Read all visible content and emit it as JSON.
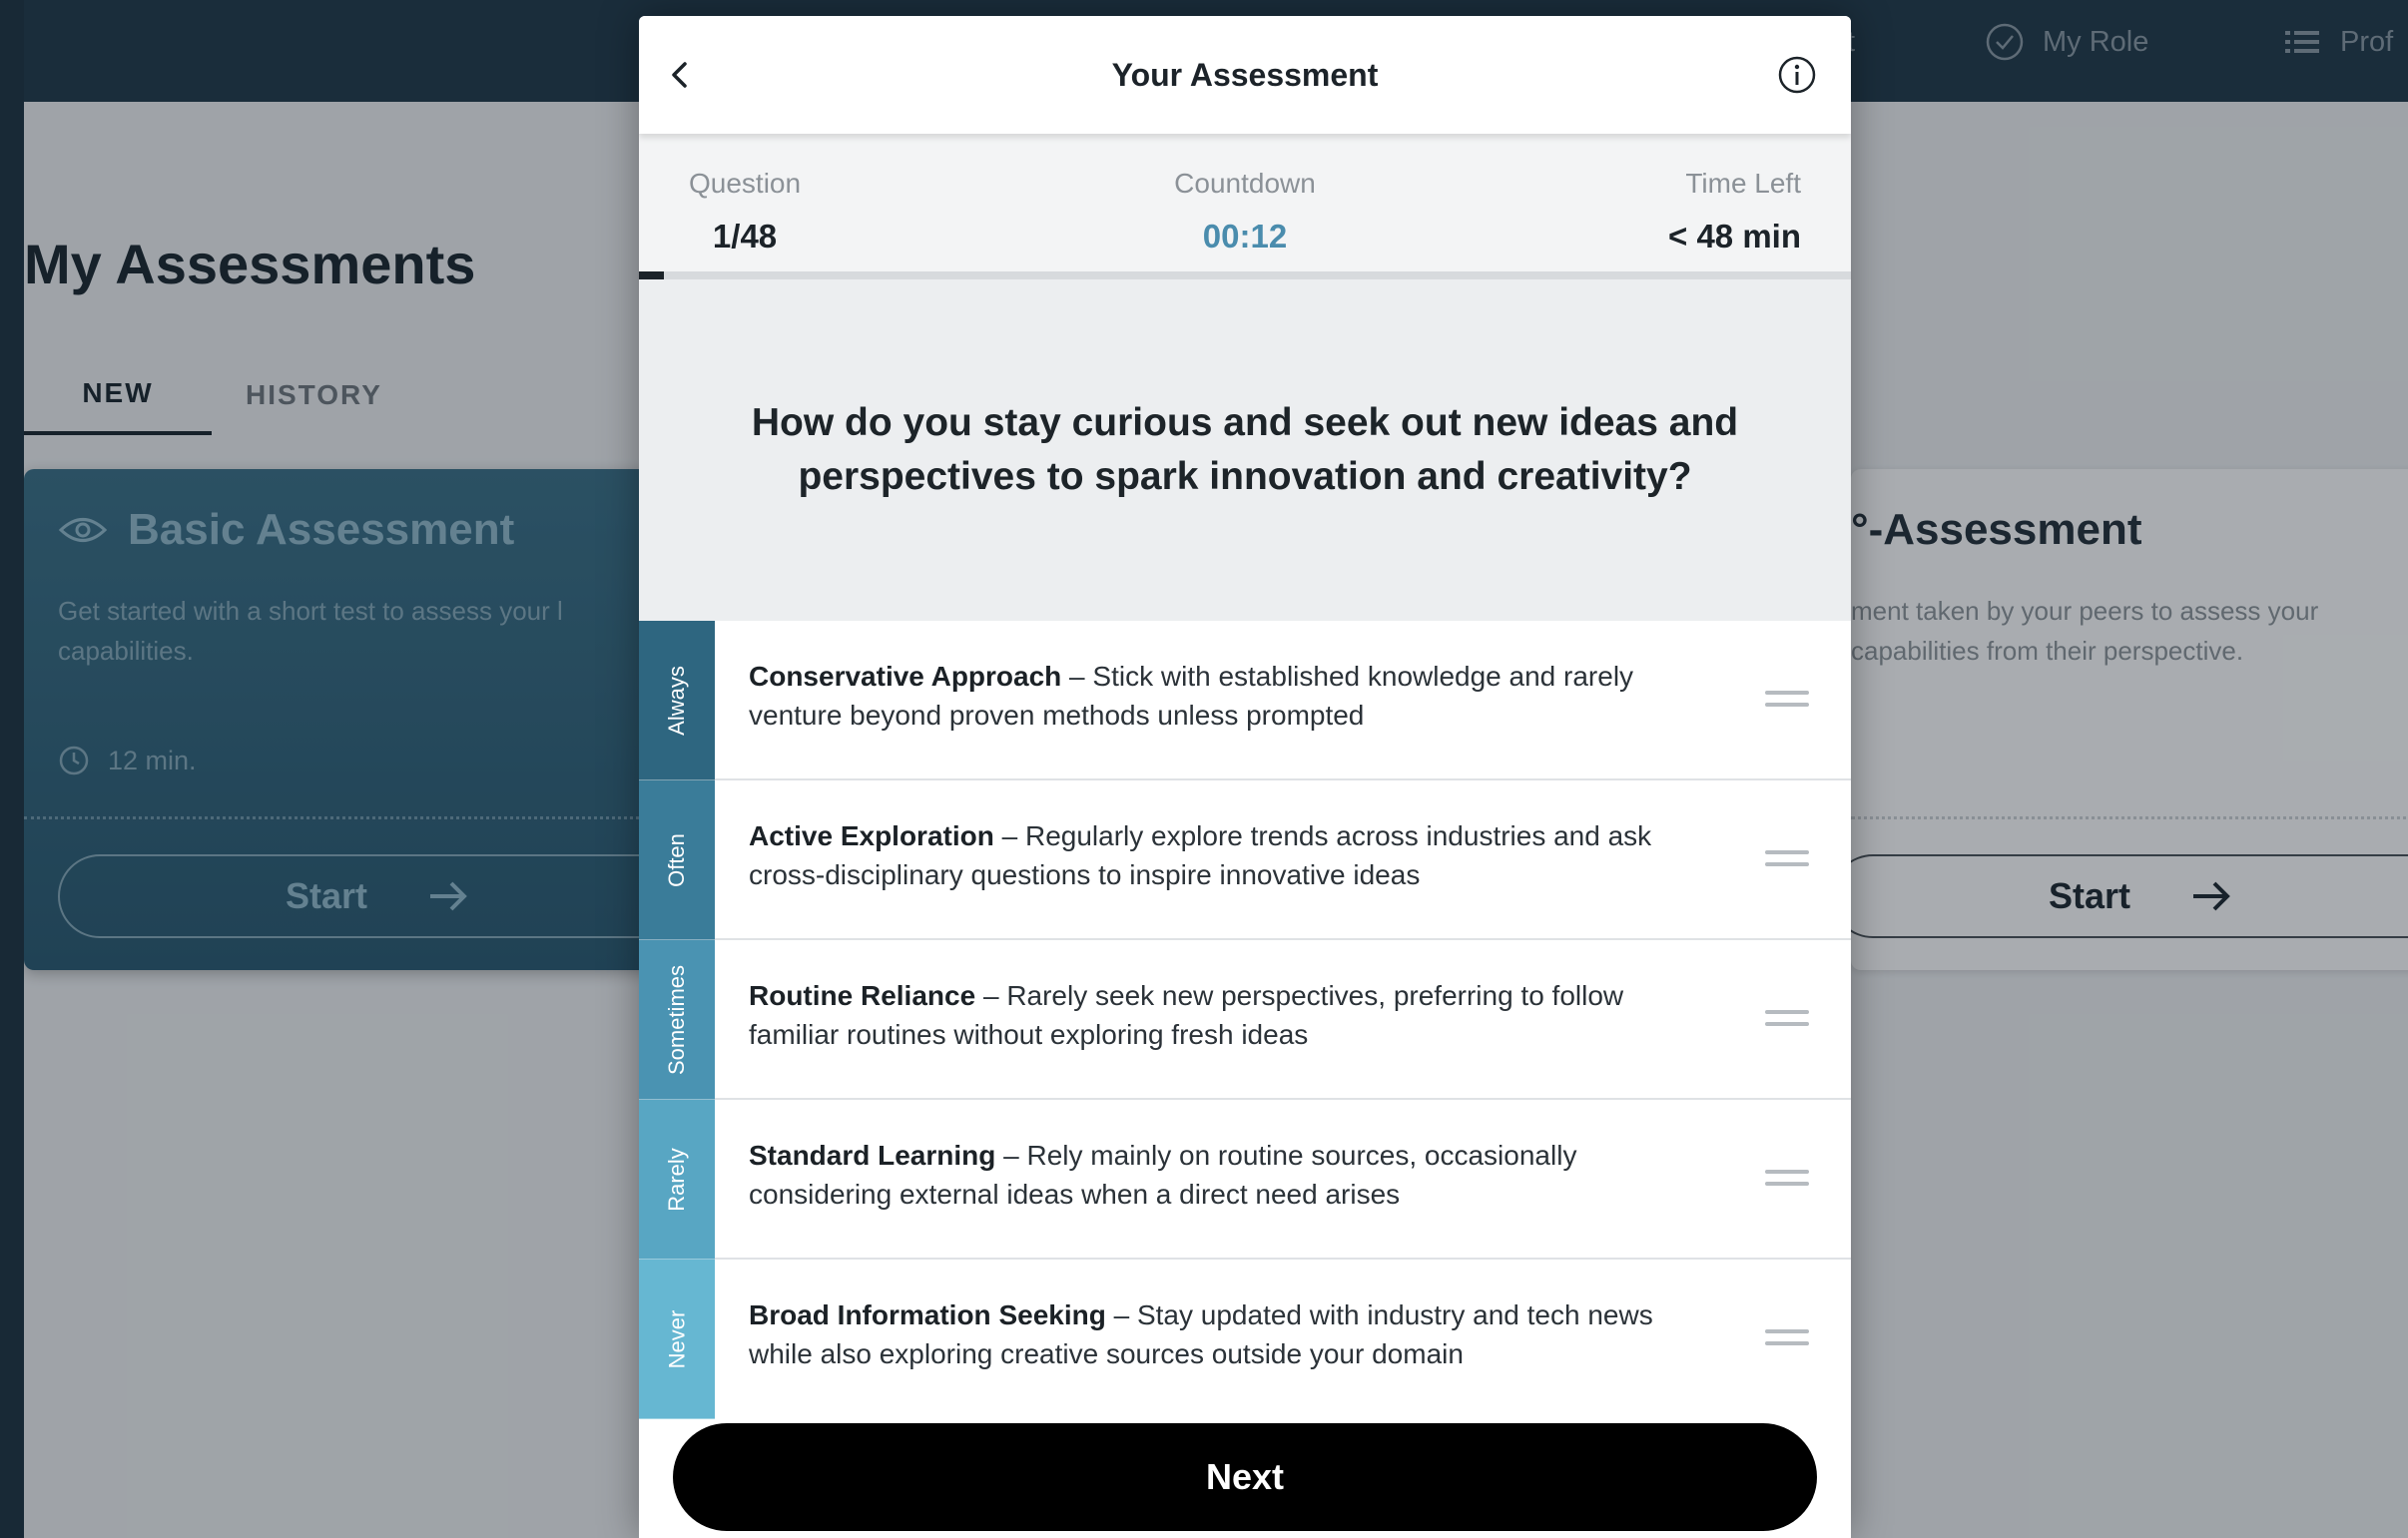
{
  "nav": {
    "cut_item": "t",
    "my_role": "My Role",
    "profile": "Prof"
  },
  "page": {
    "title": "My Assessments",
    "tabs": [
      {
        "label": "NEW",
        "active": true
      },
      {
        "label": "HISTORY",
        "active": false
      }
    ]
  },
  "cards": {
    "basic": {
      "title": "Basic Assessment",
      "description": "Get started with a short test to assess your l capabilities.",
      "duration": "12 min.",
      "start_label": "Start"
    },
    "peer": {
      "title": "°-Assessment",
      "description": "ment taken by your peers to assess your capabilities from their perspective.",
      "start_label": "Start"
    }
  },
  "modal": {
    "title": "Your Assessment",
    "stats": {
      "question_label": "Question",
      "question_value": "1/48",
      "countdown_label": "Countdown",
      "countdown_value": "00:12",
      "time_left_label": "Time Left",
      "time_left_value": "< 48 min"
    },
    "progress_fraction": 0.0208,
    "question": "How do you stay curious and seek out new ideas and perspectives to spark innovation and creativity?",
    "scale": [
      "Always",
      "Often",
      "Sometimes",
      "Rarely",
      "Never"
    ],
    "scale_colors": [
      "#2e6680",
      "#3a7c99",
      "#4a93b2",
      "#58a6c3",
      "#66b7d2"
    ],
    "options": [
      {
        "title": "Conservative Approach",
        "text": "Stick with established knowledge and rarely venture beyond proven methods unless prompted"
      },
      {
        "title": "Active Exploration",
        "text": "Regularly explore trends across industries and ask cross-disciplinary questions to inspire innovative ideas"
      },
      {
        "title": "Routine Reliance",
        "text": "Rarely seek new perspectives, preferring to follow familiar routines without exploring fresh ideas"
      },
      {
        "title": "Standard Learning",
        "text": "Rely mainly on routine sources, occasionally considering external ideas when a direct need arises"
      },
      {
        "title": "Broad Information Seeking",
        "text": "Stay updated with industry and tech news while also exploring creative sources outside your domain"
      }
    ],
    "separator": " – ",
    "next_label": "Next"
  }
}
